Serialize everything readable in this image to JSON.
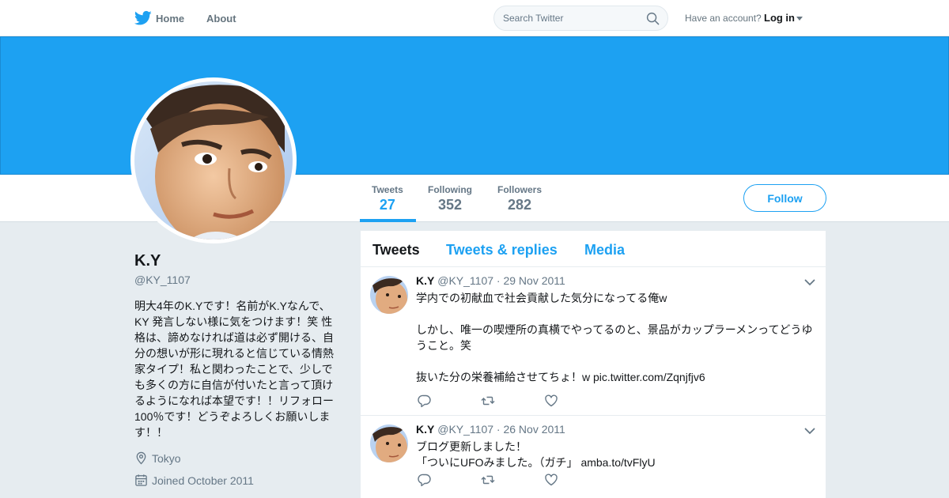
{
  "nav": {
    "home_label": "Home",
    "about_label": "About",
    "search_placeholder": "Search Twitter",
    "account_prompt": "Have an account?",
    "login_label": "Log in"
  },
  "colors": {
    "brand": "#1da1f2",
    "text": "#14171a",
    "muted": "#657786",
    "background": "#e6ecf0"
  },
  "stats": [
    {
      "label": "Tweets",
      "value": "27",
      "active": true
    },
    {
      "label": "Following",
      "value": "352",
      "active": false
    },
    {
      "label": "Followers",
      "value": "282",
      "active": false
    }
  ],
  "follow_label": "Follow",
  "profile": {
    "name": "K.Y",
    "handle": "@KY_1107",
    "bio_lines": [
      "明大4年のK.Yです！名前がK.Yなんで、",
      "KY 発言しない様に気をつけます！笑 性",
      "格は、諦めなければ道は必ず開ける、自",
      "分の想いが形に現れると信じている情熱",
      "家タイプ！私と関わったことで、少しで",
      "も多くの方に自信が付いたと言って頂け",
      "るようになれば本望です！！リフォロー",
      "100％です！どうぞよろしくお願いしま",
      "す！！"
    ],
    "location": "Tokyo",
    "joined": "Joined October 2011"
  },
  "tabs": [
    {
      "label": "Tweets",
      "active": true
    },
    {
      "label": "Tweets & replies",
      "active": false
    },
    {
      "label": "Media",
      "active": false
    }
  ],
  "tweets": [
    {
      "name": "K.Y",
      "handle": "@KY_1107",
      "separator": "·",
      "date": "29 Nov 2011",
      "lines": [
        "学内での初献血で社会貢献した気分になってる俺w",
        "",
        "しかし、唯一の喫煙所の真横でやってるのと、景品がカップラーメンってどうゆ",
        "うこと。笑",
        "",
        "抜いた分の栄養補給させてちょ！w pic.twitter.com/Zqnjfjv6"
      ]
    },
    {
      "name": "K.Y",
      "handle": "@KY_1107",
      "separator": "·",
      "date": "26 Nov 2011",
      "lines": [
        "ブログ更新しました！",
        "「ついにUFOみました。（ガチ」 amba.to/tvFlyU"
      ]
    }
  ]
}
